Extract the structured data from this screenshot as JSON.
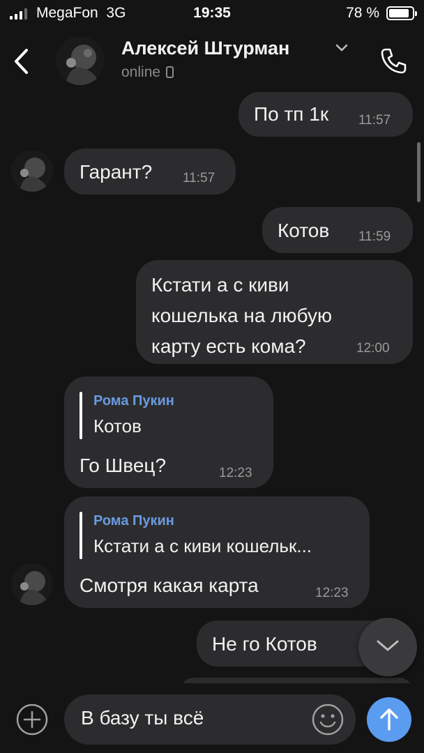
{
  "status_bar": {
    "carrier": "MegaFon",
    "network": "3G",
    "time": "19:35",
    "battery": "78 %",
    "battery_level": 0.78
  },
  "header": {
    "contact_name": "Алексей Штурман",
    "status": "online",
    "icons": [
      "back-chevron-icon",
      "dropdown-chevron-icon",
      "mobile-device-icon",
      "phone-icon"
    ]
  },
  "messages": [
    {
      "direction": "out",
      "text": "По тп 1к",
      "time": "11:57"
    },
    {
      "direction": "in",
      "text": "Гарант?",
      "time": "11:57"
    },
    {
      "direction": "out",
      "text": "Котов",
      "time": "11:59"
    },
    {
      "direction": "out",
      "text": "Кстати а с киви\nкошелька на любую\nкарту есть кома?",
      "time": "12:00"
    },
    {
      "direction": "in",
      "reply_to": {
        "author": "Рома Пукин",
        "text": "Котов"
      },
      "text": "Го Швец?",
      "time": "12:23"
    },
    {
      "direction": "in",
      "reply_to": {
        "author": "Рома Пукин",
        "text": "Кстати а с киви кошельк..."
      },
      "text": "Смотря какая карта",
      "time": "12:23"
    },
    {
      "direction": "out",
      "text": "Не го Котов",
      "time": ""
    }
  ],
  "input": {
    "value": "В базу ты всё",
    "icons": [
      "attach-plus-icon",
      "emoji-icon",
      "send-arrow-icon"
    ]
  },
  "colors": {
    "background": "#141414",
    "bubble": "#2c2c2e",
    "accent": "#5a9cf0",
    "reply_author": "#6a9ae0"
  }
}
